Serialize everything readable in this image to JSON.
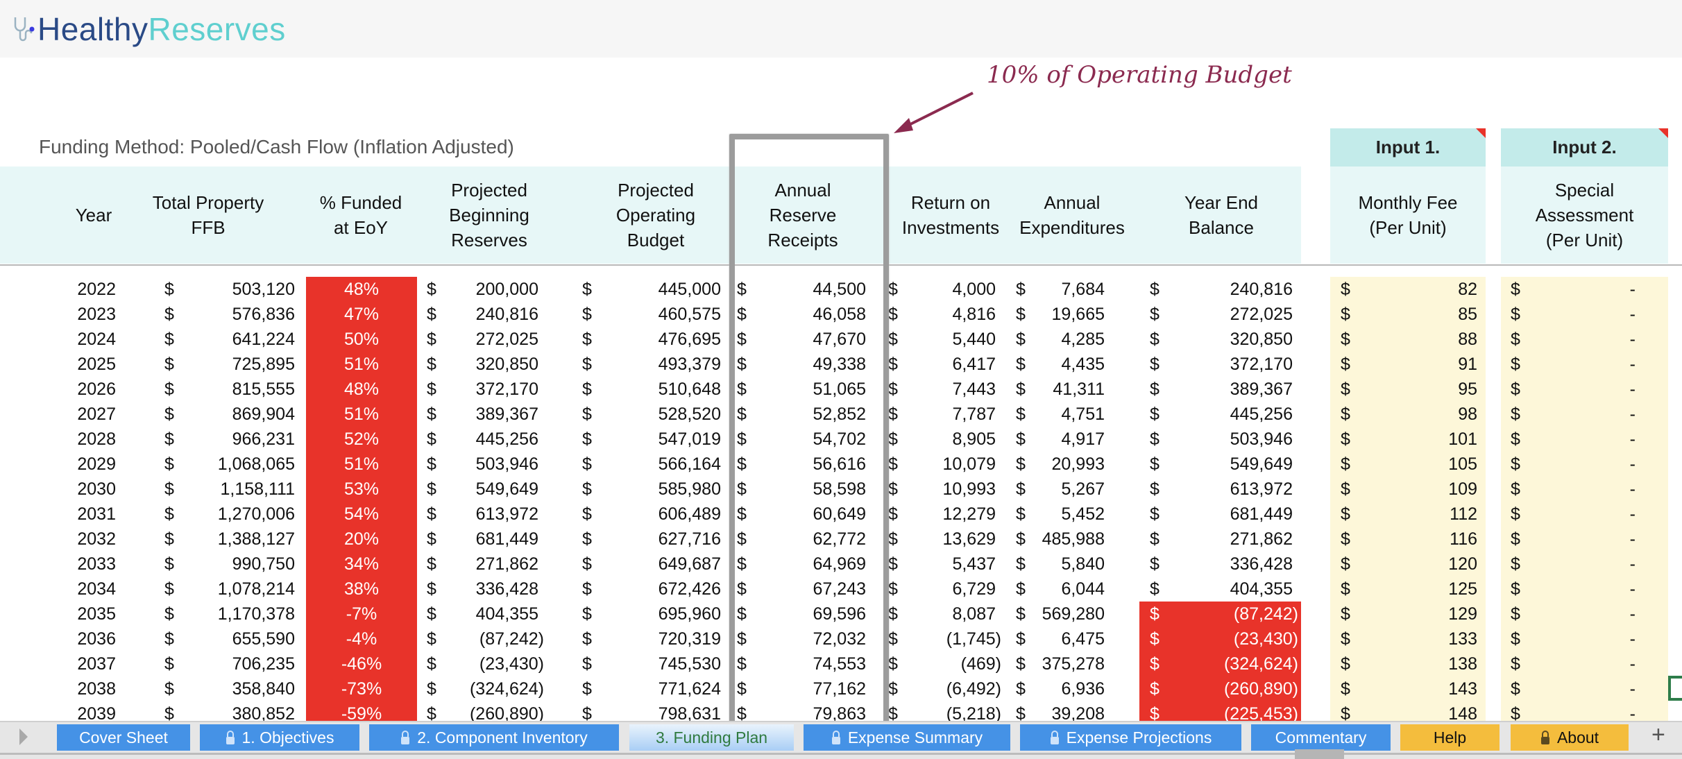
{
  "app": {
    "brand_part1": "Healthy",
    "brand_part2": "Reserves",
    "logo_icon": "stethoscope-icon"
  },
  "annotation": {
    "text": "10% of Operating Budget",
    "color": "#8b2a4f"
  },
  "funding_method": "Funding Method:  Pooled/Cash Flow (Inflation Adjusted)",
  "inputs": [
    {
      "title": "Input 1.",
      "header": "Monthly Fee\n(Per Unit)"
    },
    {
      "title": "Input 2.",
      "header": "Special\nAssessment\n(Per Unit)"
    }
  ],
  "columns": [
    "Year",
    "Total Property\nFFB",
    "% Funded\nat EoY",
    "Projected\nBeginning\nReserves",
    "Projected\nOperating\nBudget",
    "Annual\nReserve\nReceipts",
    "Return on\nInvestments",
    "Annual\nExpenditures",
    "Year End\nBalance"
  ],
  "currency_symbol": "$",
  "colors": {
    "alert": "#e8332a",
    "input_fill": "#fdf7d9",
    "header_fill": "#e7f7f7",
    "tab_blue": "#4592e6",
    "tab_yellow": "#f4bd3d"
  },
  "rows": [
    {
      "year": "2022",
      "ffb": "503,120",
      "pct": "48%",
      "beg": "200,000",
      "opb": "445,000",
      "rec": "44,500",
      "roi": "4,000",
      "exp": "7,684",
      "yeb": "240,816",
      "fee": "82",
      "sa": "-"
    },
    {
      "year": "2023",
      "ffb": "576,836",
      "pct": "47%",
      "beg": "240,816",
      "opb": "460,575",
      "rec": "46,058",
      "roi": "4,816",
      "exp": "19,665",
      "yeb": "272,025",
      "fee": "85",
      "sa": "-"
    },
    {
      "year": "2024",
      "ffb": "641,224",
      "pct": "50%",
      "beg": "272,025",
      "opb": "476,695",
      "rec": "47,670",
      "roi": "5,440",
      "exp": "4,285",
      "yeb": "320,850",
      "fee": "88",
      "sa": "-"
    },
    {
      "year": "2025",
      "ffb": "725,895",
      "pct": "51%",
      "beg": "320,850",
      "opb": "493,379",
      "rec": "49,338",
      "roi": "6,417",
      "exp": "4,435",
      "yeb": "372,170",
      "fee": "91",
      "sa": "-"
    },
    {
      "year": "2026",
      "ffb": "815,555",
      "pct": "48%",
      "beg": "372,170",
      "opb": "510,648",
      "rec": "51,065",
      "roi": "7,443",
      "exp": "41,311",
      "yeb": "389,367",
      "fee": "95",
      "sa": "-"
    },
    {
      "year": "2027",
      "ffb": "869,904",
      "pct": "51%",
      "beg": "389,367",
      "opb": "528,520",
      "rec": "52,852",
      "roi": "7,787",
      "exp": "4,751",
      "yeb": "445,256",
      "fee": "98",
      "sa": "-"
    },
    {
      "year": "2028",
      "ffb": "966,231",
      "pct": "52%",
      "beg": "445,256",
      "opb": "547,019",
      "rec": "54,702",
      "roi": "8,905",
      "exp": "4,917",
      "yeb": "503,946",
      "fee": "101",
      "sa": "-"
    },
    {
      "year": "2029",
      "ffb": "1,068,065",
      "pct": "51%",
      "beg": "503,946",
      "opb": "566,164",
      "rec": "56,616",
      "roi": "10,079",
      "exp": "20,993",
      "yeb": "549,649",
      "fee": "105",
      "sa": "-"
    },
    {
      "year": "2030",
      "ffb": "1,158,111",
      "pct": "53%",
      "beg": "549,649",
      "opb": "585,980",
      "rec": "58,598",
      "roi": "10,993",
      "exp": "5,267",
      "yeb": "613,972",
      "fee": "109",
      "sa": "-"
    },
    {
      "year": "2031",
      "ffb": "1,270,006",
      "pct": "54%",
      "beg": "613,972",
      "opb": "606,489",
      "rec": "60,649",
      "roi": "12,279",
      "exp": "5,452",
      "yeb": "681,449",
      "fee": "112",
      "sa": "-"
    },
    {
      "year": "2032",
      "ffb": "1,388,127",
      "pct": "20%",
      "beg": "681,449",
      "opb": "627,716",
      "rec": "62,772",
      "roi": "13,629",
      "exp": "485,988",
      "yeb": "271,862",
      "fee": "116",
      "sa": "-"
    },
    {
      "year": "2033",
      "ffb": "990,750",
      "pct": "34%",
      "beg": "271,862",
      "opb": "649,687",
      "rec": "64,969",
      "roi": "5,437",
      "exp": "5,840",
      "yeb": "336,428",
      "fee": "120",
      "sa": "-"
    },
    {
      "year": "2034",
      "ffb": "1,078,214",
      "pct": "38%",
      "beg": "336,428",
      "opb": "672,426",
      "rec": "67,243",
      "roi": "6,729",
      "exp": "6,044",
      "yeb": "404,355",
      "fee": "125",
      "sa": "-"
    },
    {
      "year": "2035",
      "ffb": "1,170,378",
      "pct": "-7%",
      "beg": "404,355",
      "opb": "695,960",
      "rec": "69,596",
      "roi": "8,087",
      "exp": "569,280",
      "yeb": "(87,242)",
      "fee": "129",
      "sa": "-"
    },
    {
      "year": "2036",
      "ffb": "655,590",
      "pct": "-4%",
      "beg": "(87,242)",
      "opb": "720,319",
      "rec": "72,032",
      "roi": "(1,745)",
      "exp": "6,475",
      "yeb": "(23,430)",
      "fee": "133",
      "sa": "-"
    },
    {
      "year": "2037",
      "ffb": "706,235",
      "pct": "-46%",
      "beg": "(23,430)",
      "opb": "745,530",
      "rec": "74,553",
      "roi": "(469)",
      "exp": "375,278",
      "yeb": "(324,624)",
      "fee": "138",
      "sa": "-"
    },
    {
      "year": "2038",
      "ffb": "358,840",
      "pct": "-73%",
      "beg": "(324,624)",
      "opb": "771,624",
      "rec": "77,162",
      "roi": "(6,492)",
      "exp": "6,936",
      "yeb": "(260,890)",
      "fee": "143",
      "sa": "-"
    },
    {
      "year": "2039",
      "ffb": "380,852",
      "pct": "-59%",
      "beg": "(260,890)",
      "opb": "798,631",
      "rec": "79,863",
      "roi": "(5,218)",
      "exp": "39,208",
      "yeb": "(225,453)",
      "fee": "148",
      "sa": "-"
    }
  ],
  "tabs": [
    {
      "label": "Cover Sheet",
      "locked": false,
      "style": "blue"
    },
    {
      "label": "1. Objectives",
      "locked": true,
      "style": "blue"
    },
    {
      "label": "2. Component Inventory",
      "locked": true,
      "style": "blue"
    },
    {
      "label": "3. Funding Plan",
      "locked": false,
      "style": "active"
    },
    {
      "label": "Expense Summary",
      "locked": true,
      "style": "blue"
    },
    {
      "label": "Expense Projections",
      "locked": true,
      "style": "blue"
    },
    {
      "label": "Commentary",
      "locked": false,
      "style": "blue"
    },
    {
      "label": "Help",
      "locked": false,
      "style": "yellow"
    },
    {
      "label": "About",
      "locked": true,
      "style": "yellow"
    }
  ],
  "add_tab_label": "+"
}
